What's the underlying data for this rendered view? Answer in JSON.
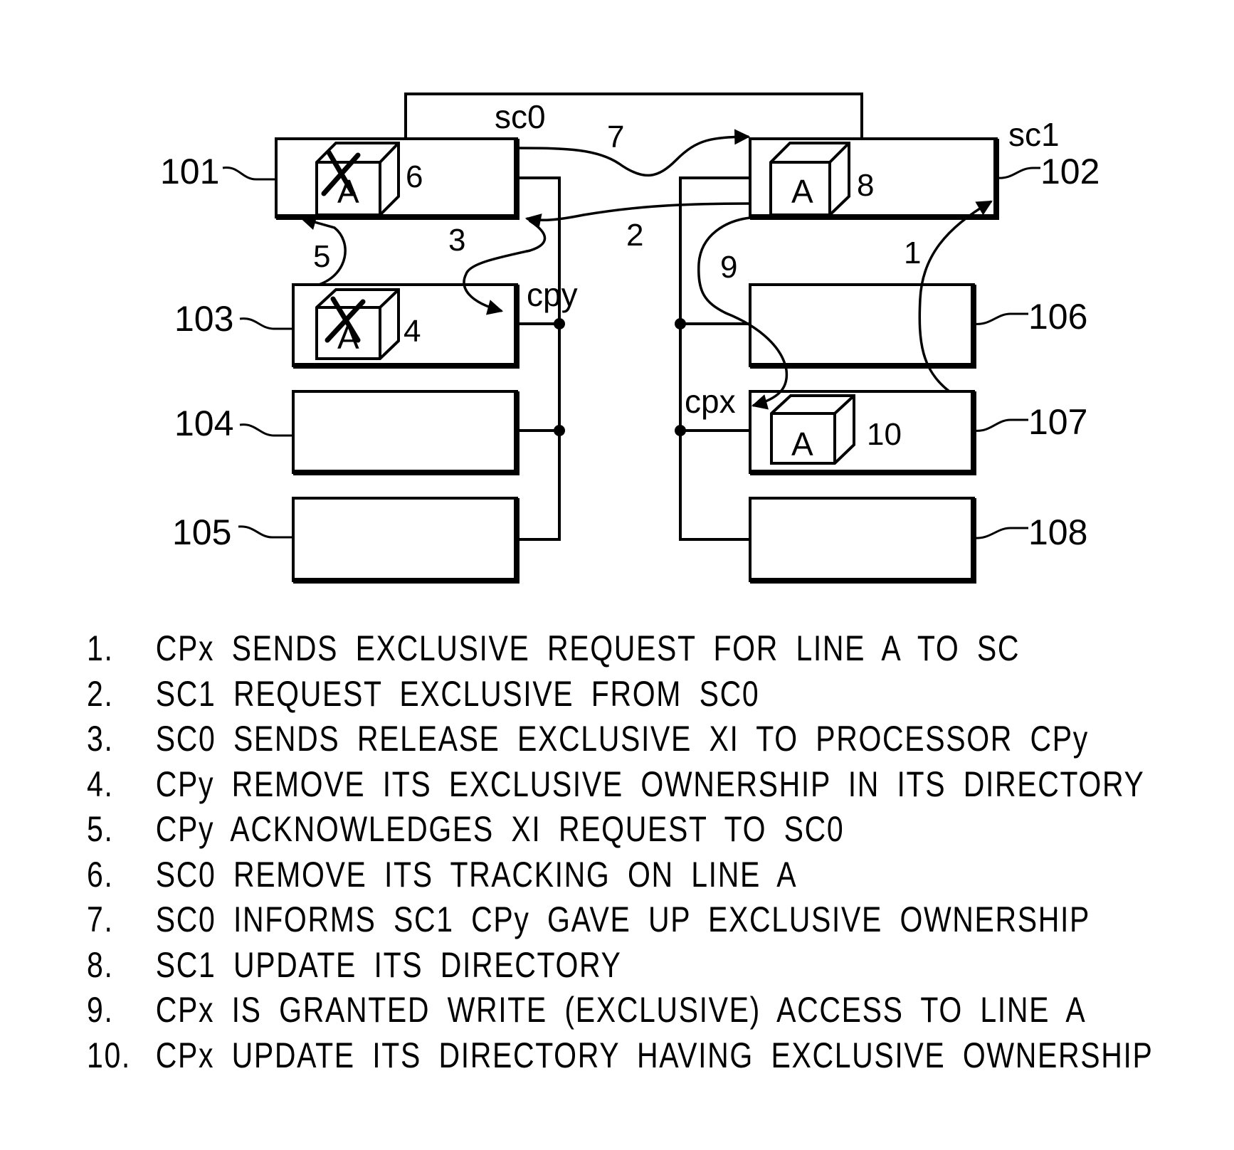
{
  "diagram": {
    "controllers": [
      {
        "id": "sc0",
        "label": "sc0",
        "ref": "101",
        "line": "A",
        "line_step": "6",
        "crossed_out": true
      },
      {
        "id": "sc1",
        "label": "sc1",
        "ref": "102",
        "line": "A",
        "line_step": "8",
        "crossed_out": false
      }
    ],
    "processors_left": [
      {
        "ref": "103",
        "label": "cpy",
        "line": "A",
        "line_step": "4",
        "crossed_out": true
      },
      {
        "ref": "104"
      },
      {
        "ref": "105"
      }
    ],
    "processors_right": [
      {
        "ref": "106"
      },
      {
        "ref": "107",
        "label": "cpx",
        "line": "A",
        "line_step": "10",
        "crossed_out": false
      },
      {
        "ref": "108"
      }
    ],
    "arrows": [
      {
        "step": "1",
        "from": "107",
        "to": "sc1"
      },
      {
        "step": "2",
        "from": "sc1",
        "to": "sc0"
      },
      {
        "step": "3",
        "from": "sc0",
        "to": "103"
      },
      {
        "step": "5",
        "from": "103",
        "to": "sc0"
      },
      {
        "step": "7",
        "from": "sc0",
        "to": "sc1"
      },
      {
        "step": "9",
        "from": "sc1",
        "to": "107"
      }
    ]
  },
  "legend": [
    {
      "num": "1.",
      "text": "CPx SENDS EXCLUSIVE REQUEST FOR LINE A TO SC"
    },
    {
      "num": "2.",
      "text": "SC1 REQUEST EXCLUSIVE FROM SC0"
    },
    {
      "num": "3.",
      "text": "SC0 SENDS RELEASE EXCLUSIVE XI TO PROCESSOR CPy"
    },
    {
      "num": "4.",
      "text": "CPy REMOVE ITS EXCLUSIVE OWNERSHIP IN ITS DIRECTORY"
    },
    {
      "num": "5.",
      "text": "CPy ACKNOWLEDGES XI REQUEST TO SC0"
    },
    {
      "num": "6.",
      "text": "SC0 REMOVE ITS TRACKING ON LINE A"
    },
    {
      "num": "7.",
      "text": "SC0 INFORMS SC1 CPy GAVE UP EXCLUSIVE OWNERSHIP"
    },
    {
      "num": "8.",
      "text": "SC1 UPDATE ITS DIRECTORY"
    },
    {
      "num": "9.",
      "text": "CPx IS GRANTED WRITE (EXCLUSIVE) ACCESS TO LINE A"
    },
    {
      "num": "10.",
      "text": "CPx UPDATE ITS DIRECTORY HAVING EXCLUSIVE OWNERSHIP"
    }
  ]
}
